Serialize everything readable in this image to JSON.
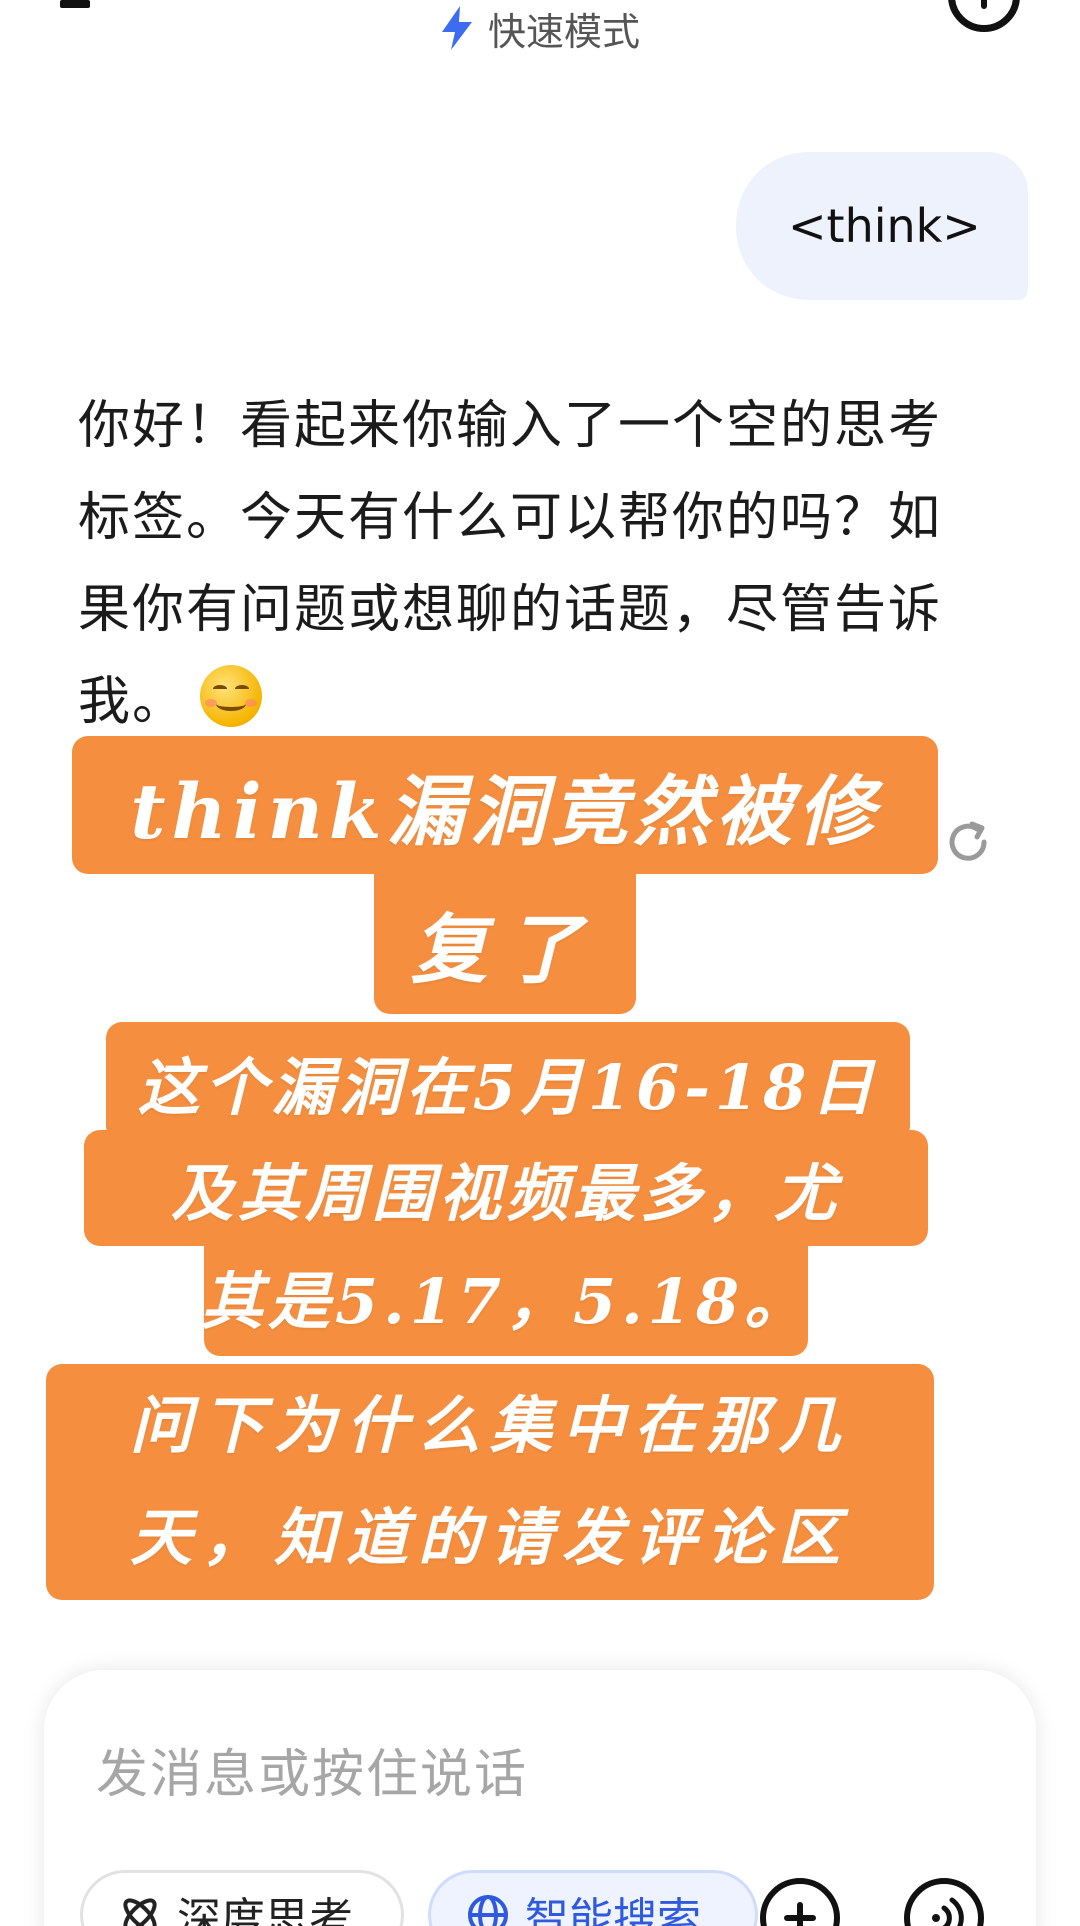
{
  "header": {
    "mode_label": "快速模式",
    "mode_icon": "lightning-icon",
    "menu_icon": "menu-icon",
    "right_icon": "history-icon"
  },
  "conversation": {
    "user_message": "<think>",
    "reply_lines": [
      "你好！看起来你输入了一个空的思考",
      "标签。今天有什么可以帮你的吗？如",
      "果你有问题或想聊的话题，尽管告诉",
      "我。"
    ],
    "reply_emoji": "smiling-face-emoji",
    "regenerate_icon": "refresh-icon"
  },
  "overlay_captions": {
    "caption1_line1": "think漏洞竟然被修",
    "caption1_line2": "复了",
    "caption2_line1": "这个漏洞在5月16-18日",
    "caption2_line2": "及其周围视频最多，尤",
    "caption2_line3": "其是5.17，5.18。",
    "caption3_line1": "问下为什么集中在那几",
    "caption3_line2": "天，知道的请发评论区",
    "accent_color": "#f58f3f"
  },
  "composer": {
    "placeholder": "发消息或按住说话",
    "deep_think_label": "深度思考",
    "smart_search_label": "智能搜索",
    "search_accent": "#2f5ae0"
  }
}
